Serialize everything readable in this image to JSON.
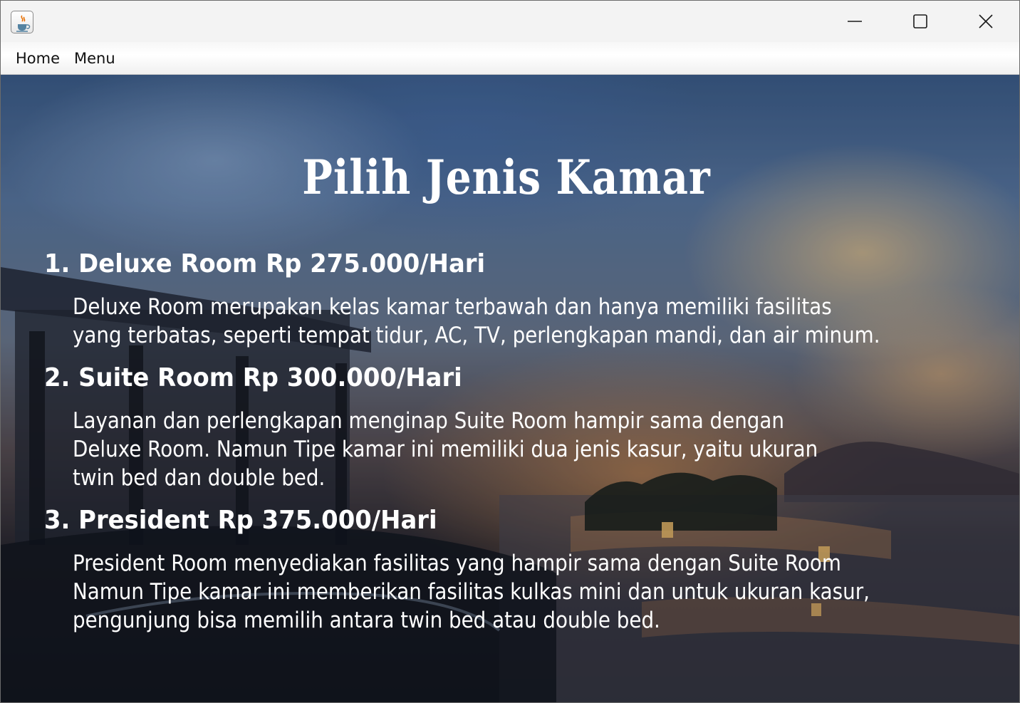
{
  "window": {
    "app_icon": "java-coffee-cup-icon",
    "controls": {
      "minimize_icon": "minimize-icon",
      "maximize_icon": "maximize-icon",
      "close_icon": "close-icon"
    }
  },
  "menubar": {
    "items": [
      {
        "label": "Home"
      },
      {
        "label": "Menu"
      }
    ]
  },
  "main": {
    "title": "Pilih Jenis Kamar",
    "rooms": [
      {
        "heading": "1. Deluxe Room Rp 275.000/Hari",
        "description_lines": [
          "Deluxe Room merupakan kelas kamar terbawah dan hanya memiliki fasilitas",
          "yang terbatas, seperti tempat tidur, AC, TV, perlengkapan mandi, dan air minum."
        ]
      },
      {
        "heading": "2. Suite Room Rp 300.000/Hari",
        "description_lines": [
          "Layanan dan perlengkapan menginap Suite Room hampir sama dengan",
          "Deluxe Room. Namun Tipe kamar ini memiliki dua jenis kasur, yaitu ukuran",
          "twin bed dan double bed."
        ]
      },
      {
        "heading": "3. President Rp 375.000/Hari",
        "description_lines": [
          "President Room menyediakan fasilitas yang hampir sama dengan Suite Room",
          "Namun Tipe kamar ini memberikan fasilitas kulkas mini dan untuk ukuran kasur,",
          "pengunjung bisa memilih antara twin bed atau double bed."
        ]
      }
    ]
  },
  "colors": {
    "text": "#ffffff",
    "titlebar": "#f3f3f3",
    "menubar": "#ffffff"
  }
}
